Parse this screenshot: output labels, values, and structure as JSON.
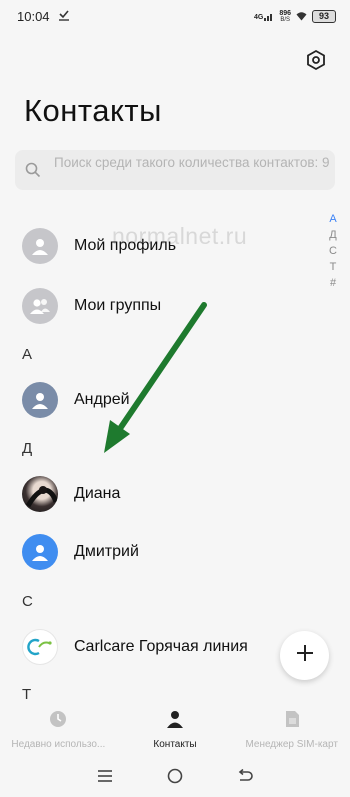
{
  "status_bar": {
    "time": "10:04",
    "network": "4G",
    "speed_value": "896",
    "speed_unit": "B/S",
    "battery": "93"
  },
  "header": {
    "title": "Контакты"
  },
  "search": {
    "placeholder": "Поиск среди такого количества контактов: 9"
  },
  "index_letters": [
    "А",
    "Д",
    "С",
    "Т",
    "#"
  ],
  "watermark": "normalnet.ru",
  "contacts": {
    "my_profile": "Мой профиль",
    "my_groups": "Мои группы",
    "section_a": "А",
    "andrey": "Андрей",
    "section_d": "Д",
    "diana": "Диана",
    "dmitry": "Дмитрий",
    "section_c": "С",
    "carlcare": "Carlcare Горячая линия",
    "section_t": "Т"
  },
  "bottom_nav": {
    "recent": "Недавно использо...",
    "contacts": "Контакты",
    "sim_manager": "Менеджер SIM-карт"
  },
  "colors": {
    "accent": "#3b82f6",
    "avatar_gray": "#c6c6ca",
    "avatar_slate": "#7a8ca8",
    "avatar_blue": "#3f8df0",
    "arrow_green": "#1e7a2e"
  }
}
